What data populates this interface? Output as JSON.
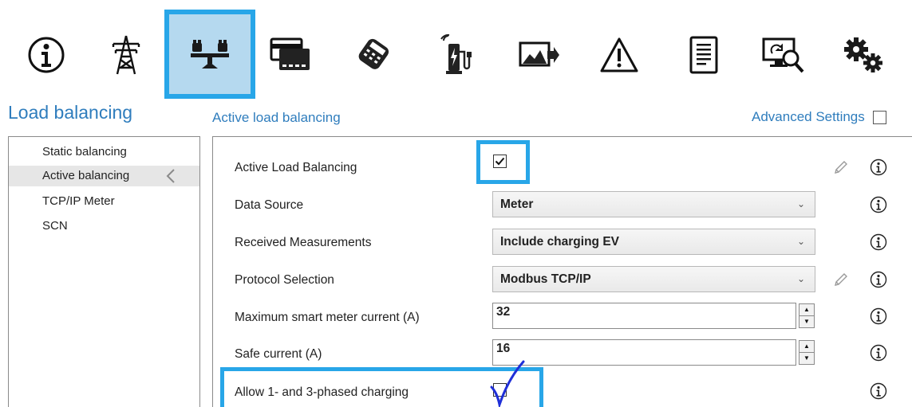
{
  "toolbar": {
    "icons": [
      "info-icon",
      "power-tower-icon",
      "load-balancing-scale-icon",
      "payment-cards-icon",
      "card-reader-icon",
      "charging-station-icon",
      "image-export-icon",
      "warning-icon",
      "document-icon",
      "remote-diagnostics-icon",
      "gears-icon"
    ],
    "active_icon": "load-balancing-scale-icon",
    "accent_color": "#28a6e8"
  },
  "page": {
    "section_title": "Load balancing",
    "sub_title": "Active load balancing",
    "advanced_settings_label": "Advanced Settings",
    "advanced_settings_checked": false
  },
  "nav": {
    "items": [
      {
        "label": "Static balancing",
        "selected": false
      },
      {
        "label": "Active balancing",
        "selected": true
      },
      {
        "label": "TCP/IP Meter",
        "selected": false
      },
      {
        "label": "SCN",
        "selected": false
      }
    ]
  },
  "settings": {
    "active_load_balancing": {
      "label": "Active Load Balancing",
      "checked": true
    },
    "data_source": {
      "label": "Data Source",
      "value": "Meter"
    },
    "received_measurements": {
      "label": "Received Measurements",
      "value": "Include charging EV"
    },
    "protocol_selection": {
      "label": "Protocol Selection",
      "value": "Modbus TCP/IP"
    },
    "max_meter_current": {
      "label": "Maximum smart meter current (A)",
      "value": "32"
    },
    "safe_current": {
      "label": "Safe current (A)",
      "value": "16"
    },
    "allow_phased": {
      "label": "Allow 1- and 3-phased charging",
      "checked": false
    }
  },
  "colors": {
    "heading_blue": "#2f7dbd",
    "highlight_blue": "#28a6e8",
    "handwritten_check": "#1f2fd8"
  }
}
